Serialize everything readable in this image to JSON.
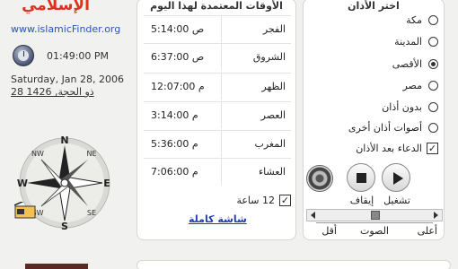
{
  "header": {
    "logo_text": "الإسلامي",
    "url": "www.islamicFinder.org"
  },
  "clock": {
    "time": "01:49:00 PM",
    "gregorian_date": "Saturday, Jan 28, 2006",
    "hijri_date": "28 ذو الحجة, 1426"
  },
  "prayer_times": {
    "title": "الأوقات المعتمدة لهذا اليوم",
    "rows": [
      {
        "name": "الفجر",
        "time": "5:14:00 ص"
      },
      {
        "name": "الشروق",
        "time": "6:37:00 ص"
      },
      {
        "name": "الظهر",
        "time": "12:07:00 م"
      },
      {
        "name": "العصر",
        "time": "3:14:00 م"
      },
      {
        "name": "المغرب",
        "time": "5:36:00 م"
      },
      {
        "name": "العشاء",
        "time": "7:06:00 م"
      }
    ],
    "hour24_label": "12 ساعة",
    "hour24_checked": "✓",
    "fullscreen_link": "شاشة كاملة"
  },
  "adhan": {
    "title": "اختر الأذان",
    "options": [
      {
        "label": "مكة",
        "selected": false
      },
      {
        "label": "المدينة",
        "selected": false
      },
      {
        "label": "الأقصى",
        "selected": true
      },
      {
        "label": "مصر",
        "selected": false
      },
      {
        "label": "بدون أذان",
        "selected": false
      },
      {
        "label": "أصوات أذان أخرى",
        "selected": false
      }
    ],
    "dua_label": "الدعاء بعد الأذان",
    "dua_checked": "✓",
    "stop_label": "إيقاف",
    "play_label": "تشغيل",
    "volume": {
      "high_label": "أعلى",
      "mid_label": "الصوت",
      "low_label": "أقل",
      "level": 0.5
    }
  },
  "compass": {
    "north": "N",
    "south": "S",
    "east": "E",
    "west": "W",
    "ne": "NE",
    "nw": "NW",
    "se": "SE",
    "sw": "SW"
  },
  "colors": {
    "accent": "#e0301e",
    "link": "#1d3fb0"
  }
}
